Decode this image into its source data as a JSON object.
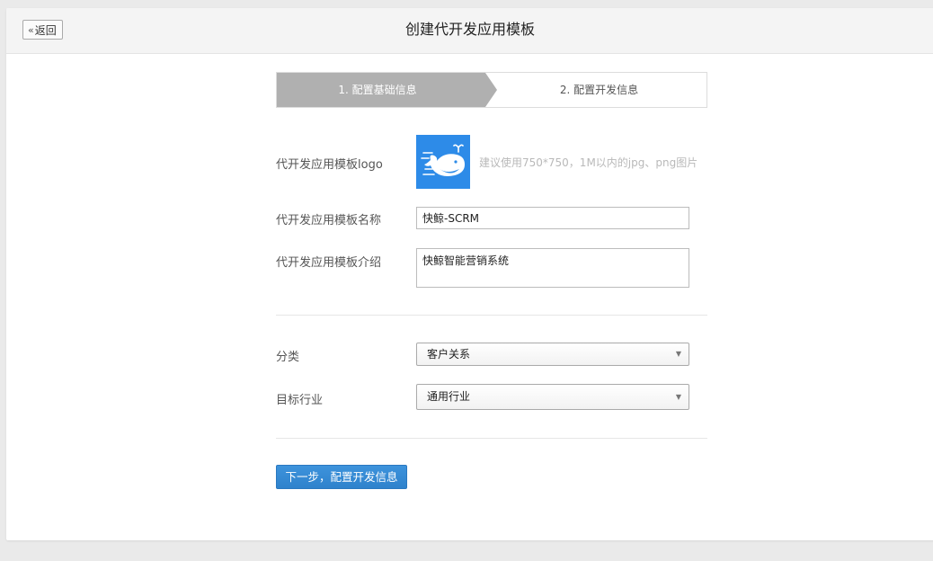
{
  "header": {
    "back_label": "返回",
    "back_icon": "double-chevron-left-icon",
    "title": "创建代开发应用模板"
  },
  "steps": [
    {
      "label": "1. 配置基础信息",
      "active": true
    },
    {
      "label": "2. 配置开发信息",
      "active": false
    }
  ],
  "form": {
    "logo": {
      "label": "代开发应用模板logo",
      "hint": "建议使用750*750，1M以内的jpg、png图片",
      "icon": "whale-logo-icon",
      "bg_color": "#2d8be8"
    },
    "name": {
      "label": "代开发应用模板名称",
      "value": "快鲸-SCRM"
    },
    "intro": {
      "label": "代开发应用模板介绍",
      "value": "快鲸智能营销系统"
    },
    "category": {
      "label": "分类",
      "value": "客户关系"
    },
    "industry": {
      "label": "目标行业",
      "value": "通用行业"
    }
  },
  "actions": {
    "next_label": "下一步，配置开发信息",
    "primary_color": "#3189d3"
  }
}
